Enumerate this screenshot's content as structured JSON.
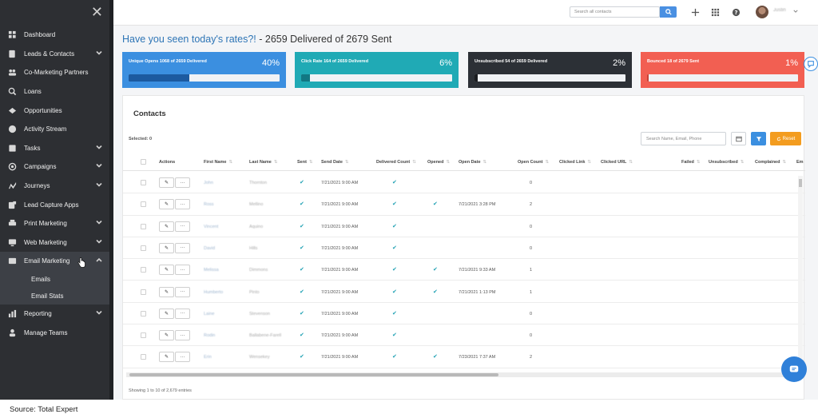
{
  "sidebar": {
    "items": [
      {
        "label": "Dashboard",
        "icon": "dashboard-icon",
        "chevron": false
      },
      {
        "label": "Leads & Contacts",
        "icon": "contacts-icon",
        "chevron": true
      },
      {
        "label": "Co-Marketing Partners",
        "icon": "partners-icon",
        "chevron": false
      },
      {
        "label": "Loans",
        "icon": "loans-icon",
        "chevron": false
      },
      {
        "label": "Opportunities",
        "icon": "opportunities-icon",
        "chevron": false
      },
      {
        "label": "Activity Stream",
        "icon": "activity-icon",
        "chevron": false
      },
      {
        "label": "Tasks",
        "icon": "tasks-icon",
        "chevron": true
      },
      {
        "label": "Campaigns",
        "icon": "campaigns-icon",
        "chevron": true
      },
      {
        "label": "Journeys",
        "icon": "journeys-icon",
        "chevron": true
      },
      {
        "label": "Lead Capture Apps",
        "icon": "lead-capture-icon",
        "chevron": false
      },
      {
        "label": "Print Marketing",
        "icon": "print-icon",
        "chevron": true
      },
      {
        "label": "Web Marketing",
        "icon": "web-icon",
        "chevron": true
      },
      {
        "label": "Email Marketing",
        "icon": "email-icon",
        "chevron": true,
        "expanded": true
      },
      {
        "label": "Reporting",
        "icon": "reporting-icon",
        "chevron": true
      },
      {
        "label": "Manage Teams",
        "icon": "teams-icon",
        "chevron": false
      }
    ],
    "sub_items": [
      "Emails",
      "Email Stats"
    ]
  },
  "topbar": {
    "search_placeholder": "Search all contacts",
    "user_name": "Justin"
  },
  "headline": {
    "question": "Have you seen today's rates?!",
    "summary": " - 2659 Delivered of 2679 Sent"
  },
  "cards": [
    {
      "label": "Unique Opens 1068 of 2659 Delivered",
      "percent": "40%",
      "fill": 0.4,
      "color": "#3b8fe0"
    },
    {
      "label": "Click Rate 164 of 2659 Delivered",
      "percent": "6%",
      "fill": 0.06,
      "color": "#20aab5"
    },
    {
      "label": "Unsubscribed 54 of 2659 Delivered",
      "percent": "2%",
      "fill": 0.02,
      "color": "#2c3036"
    },
    {
      "label": "Bounced 18 of 2679 Sent",
      "percent": "1%",
      "fill": 0.01,
      "color": "#f25f52"
    }
  ],
  "contacts": {
    "title": "Contacts",
    "selected": "Selected: 0",
    "search_placeholder": "Search Name, Email, Phone",
    "reset_label": "Reset",
    "columns": [
      "Actions",
      "First Name",
      "Last Name",
      "Sent",
      "Send Date",
      "Delivered Count",
      "Opened",
      "Open Date",
      "Open Count",
      "Clicked Link",
      "Clicked URL",
      "Failed",
      "Unsubscribed",
      "Complained",
      "Em"
    ],
    "rows": [
      {
        "first": "John",
        "last": "Thornton",
        "sent": true,
        "send_date": "7/21/2021 9:00 AM",
        "delivered": true,
        "opened": false,
        "open_date": "",
        "open_count": "0"
      },
      {
        "first": "Ross",
        "last": "Mellino",
        "sent": true,
        "send_date": "7/21/2021 9:00 AM",
        "delivered": true,
        "opened": true,
        "open_date": "7/21/2021 3:28 PM",
        "open_count": "2"
      },
      {
        "first": "Vincent",
        "last": "Aquino",
        "sent": true,
        "send_date": "7/21/2021 9:00 AM",
        "delivered": true,
        "opened": false,
        "open_date": "",
        "open_count": "0"
      },
      {
        "first": "David",
        "last": "Hills",
        "sent": true,
        "send_date": "7/21/2021 9:00 AM",
        "delivered": true,
        "opened": false,
        "open_date": "",
        "open_count": "0"
      },
      {
        "first": "Melissa",
        "last": "Dimmons",
        "sent": true,
        "send_date": "7/21/2021 9:00 AM",
        "delivered": true,
        "opened": true,
        "open_date": "7/21/2021 9:33 AM",
        "open_count": "1"
      },
      {
        "first": "Humberto",
        "last": "Pinto",
        "sent": true,
        "send_date": "7/21/2021 9:00 AM",
        "delivered": true,
        "opened": true,
        "open_date": "7/21/2021 1:13 PM",
        "open_count": "1"
      },
      {
        "first": "Laine",
        "last": "Stevenson",
        "sent": true,
        "send_date": "7/21/2021 9:00 AM",
        "delivered": true,
        "opened": false,
        "open_date": "",
        "open_count": "0"
      },
      {
        "first": "Rodin",
        "last": "Ballabene-Farell",
        "sent": true,
        "send_date": "7/21/2021 9:00 AM",
        "delivered": true,
        "opened": false,
        "open_date": "",
        "open_count": "0"
      },
      {
        "first": "Erin",
        "last": "Wensekey",
        "sent": true,
        "send_date": "7/21/2021 9:00 AM",
        "delivered": true,
        "opened": true,
        "open_date": "7/23/2021 7:37 AM",
        "open_count": "2"
      }
    ],
    "footer": "Showing 1 to 10 of 2,679 entries"
  },
  "source": "Source: Total Expert"
}
